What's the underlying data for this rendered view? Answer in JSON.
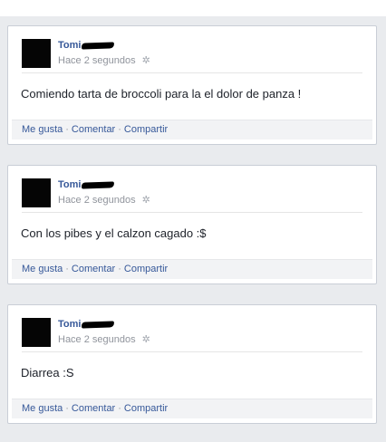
{
  "posts": [
    {
      "author": "Tomi",
      "timestamp": "Hace 2 segundos",
      "text": "Comiendo tarta de broccoli para la el dolor de panza !",
      "actions": {
        "like": "Me gusta",
        "comment": "Comentar",
        "share": "Compartir"
      }
    },
    {
      "author": "Tomi",
      "timestamp": "Hace 2 segundos",
      "text": "Con los pibes y el calzon cagado :$",
      "actions": {
        "like": "Me gusta",
        "comment": "Comentar",
        "share": "Compartir"
      }
    },
    {
      "author": "Tomi",
      "timestamp": "Hace 2 segundos",
      "text": "Diarrea :S",
      "actions": {
        "like": "Me gusta",
        "comment": "Comentar",
        "share": "Compartir"
      }
    }
  ],
  "separator": "·",
  "colors": {
    "background": "#e9ebee",
    "link": "#365899",
    "meta": "#90949c",
    "action_bar": "#f2f3f5"
  },
  "icons": {
    "privacy": "gear-icon"
  }
}
